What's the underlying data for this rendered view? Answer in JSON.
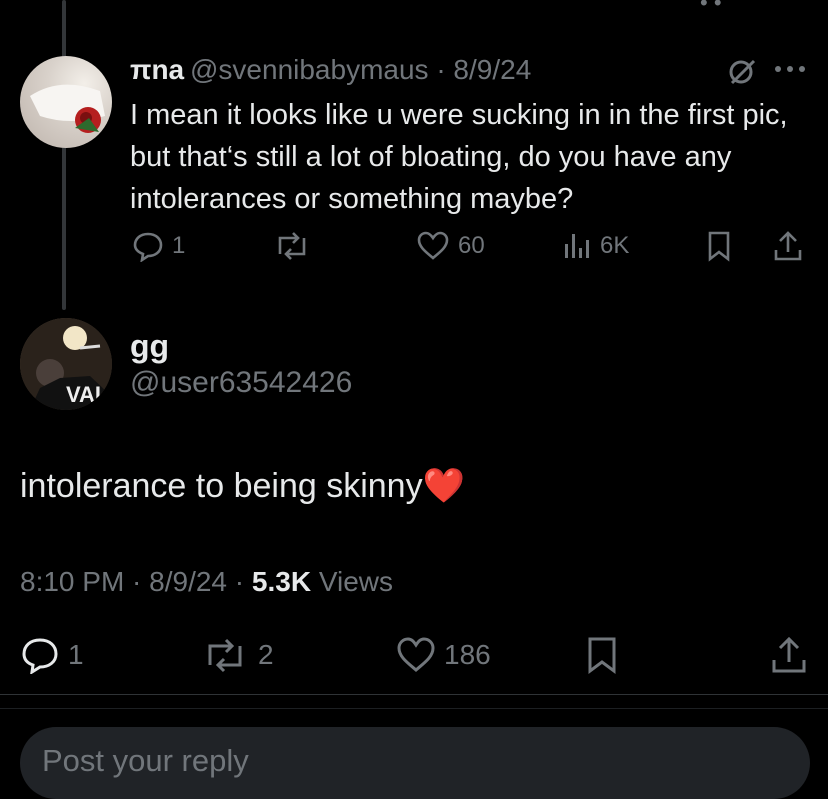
{
  "colors": {
    "background": "#000000",
    "text": "#e7e9ea",
    "muted": "#71767b",
    "heart": "#e0245e"
  },
  "parent_reply": {
    "display_name": "πna",
    "handle_date": "@svennibabymaus · 8/9/24",
    "text": "I mean it looks like u were sucking in in the first pic, but that‘s still a lot of bloating, do you have any intolerances or something maybe?",
    "stats": {
      "replies": "1",
      "likes": "60",
      "views": "6K"
    },
    "icons": [
      "comment-icon",
      "retweet-icon",
      "heart-icon",
      "views-icon",
      "bookmark-icon",
      "share-icon",
      "grok-icon",
      "more-icon"
    ]
  },
  "main_post": {
    "display_name": "gg",
    "handle": "@user63542426",
    "text": "intolerance to being skinny",
    "emoji": "❤️",
    "time": "8:10 PM · 8/9/24 · ",
    "views_count": "5.3K",
    "views_label": " Views",
    "stats": {
      "replies": "1",
      "reposts": "2",
      "likes": "186"
    }
  },
  "composer": {
    "placeholder": "Post your reply"
  }
}
